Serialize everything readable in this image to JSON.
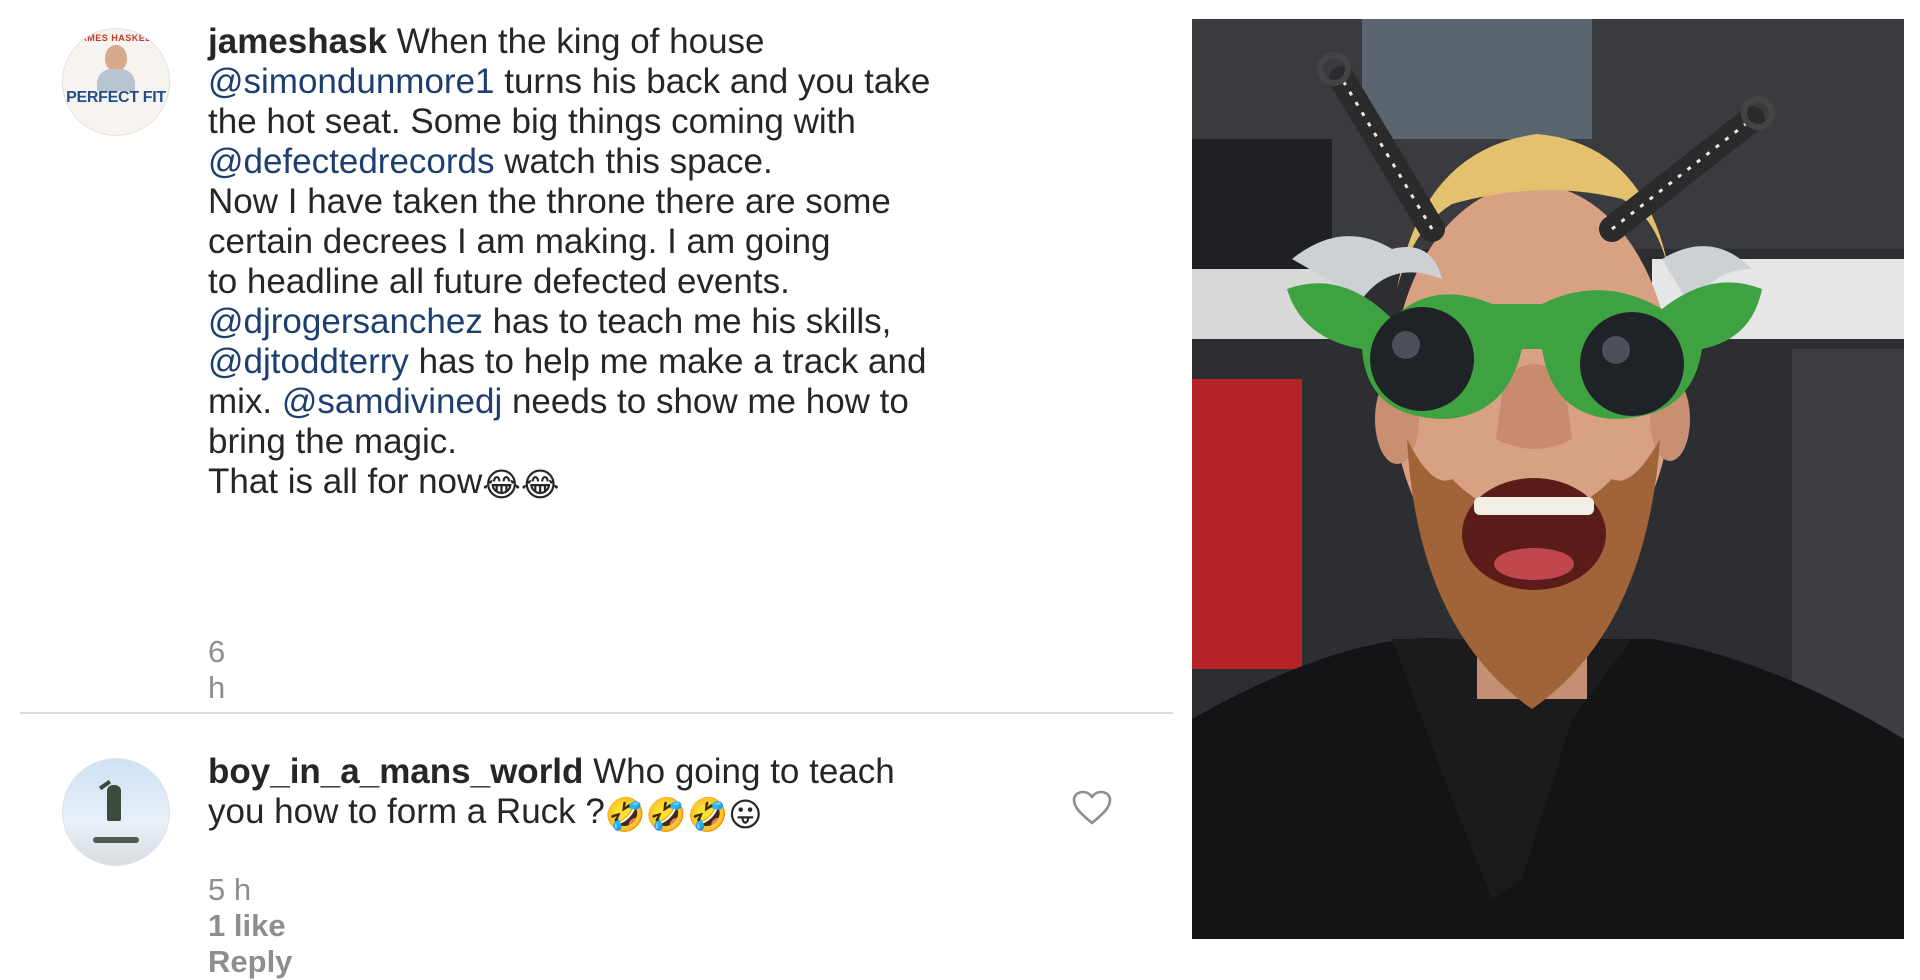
{
  "comments": [
    {
      "avatar": {
        "banner": "JAMES HASKELL",
        "title": "PERFECT FIT"
      },
      "username": "jameshask",
      "body": [
        " When the king of house\n",
        {
          "mention": "@simondunmore1"
        },
        " turns his back and you take\nthe hot seat. Some big things coming with\n",
        {
          "mention": "@defectedrecords"
        },
        " watch this space.\nNow I have taken the throne there are some\ncertain decrees I am making. I am going\nto headline all future defected events.\n",
        {
          "mention": "@djrogersanchez"
        },
        " has to teach me his skills,\n",
        {
          "mention": "@djtoddterry"
        },
        " has to help me make a track and\nmix. ",
        {
          "mention": "@samdivinedj"
        },
        " needs to show me how to\nbring the magic.\nThat is all for now",
        {
          "emoji": "😂😂"
        }
      ],
      "time": "6 h"
    },
    {
      "username": "boy_in_a_mans_world",
      "body": [
        " Who going to teach\nyou how to form a Ruck ?",
        {
          "emoji": "🤣🤣🤣😛"
        }
      ],
      "time": "5 h",
      "likes": "1 like",
      "reply": "Reply"
    }
  ],
  "icons": {
    "like": "heart-outline-icon"
  },
  "colors": {
    "mention": "#1d3f70",
    "meta": "#8e8e8e",
    "text": "#262626"
  }
}
